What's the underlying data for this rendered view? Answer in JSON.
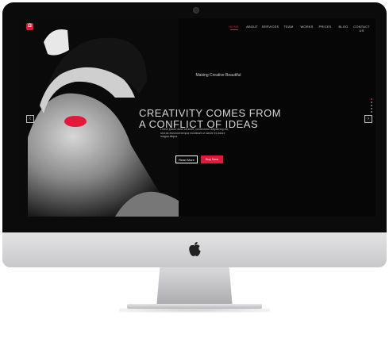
{
  "site": {
    "logo_icon": "red-square-logo-icon",
    "nav": [
      {
        "label": "Home",
        "active": true
      },
      {
        "label": "About",
        "active": false
      },
      {
        "label": "Services",
        "active": false
      },
      {
        "label": "Team",
        "active": false
      },
      {
        "label": "Works",
        "active": false
      },
      {
        "label": "Prices",
        "active": false
      },
      {
        "label": "Blog",
        "active": false
      },
      {
        "label": "Contact Us",
        "active": false
      }
    ]
  },
  "hero": {
    "tagline": "Making Creative Beautiful",
    "headline_line1": "CREATIVITY COMES FROM",
    "headline_line2": "A CONFLICT OF IDEAS",
    "lead": "Lorem ipsum dolor sit amet, consectetur adipisicing elit, sed do eiusmod tempor incididunt ut labore et dolore magna aliqua.",
    "btn_read_more": "Read More",
    "btn_buy_now": "Buy Now"
  },
  "colors": {
    "accent": "#e3173a",
    "background": "#060606"
  }
}
